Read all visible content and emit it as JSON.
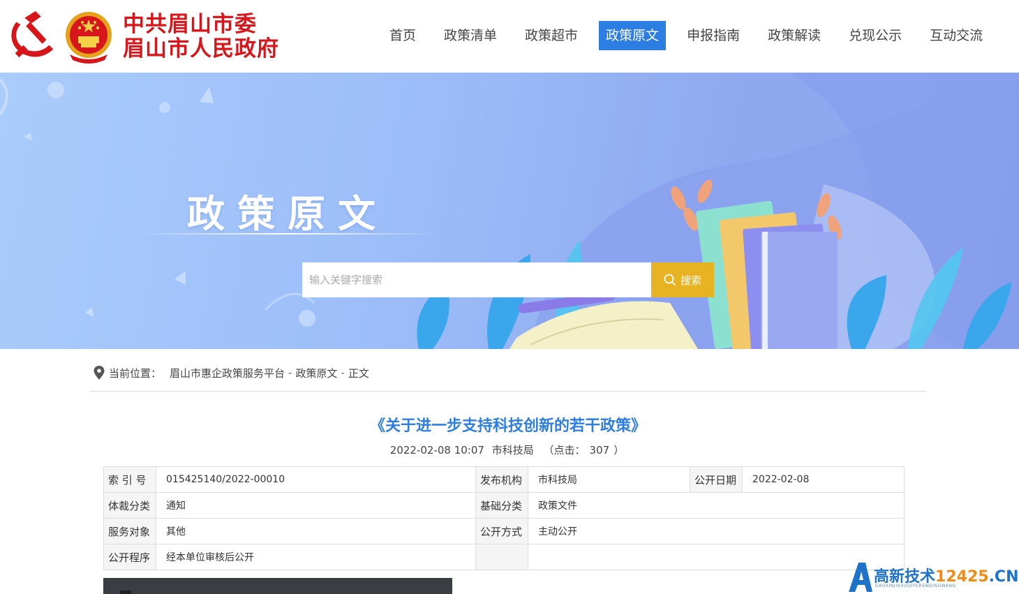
{
  "header": {
    "logo_line1": "中共眉山市委",
    "logo_line2": "眉山市人民政府",
    "nav": [
      {
        "label": "首页",
        "active": false
      },
      {
        "label": "政策清单",
        "active": false
      },
      {
        "label": "政策超市",
        "active": false
      },
      {
        "label": "政策原文",
        "active": true
      },
      {
        "label": "申报指南",
        "active": false
      },
      {
        "label": "政策解读",
        "active": false
      },
      {
        "label": "兑现公示",
        "active": false
      },
      {
        "label": "互动交流",
        "active": false
      }
    ]
  },
  "banner": {
    "title": "政策原文",
    "search_placeholder": "输入关键字搜索",
    "search_button": "搜索"
  },
  "breadcrumb": {
    "label": "当前位置：",
    "items": [
      "眉山市惠企政策服务平台",
      "政策原文",
      "正文"
    ],
    "separator": "-"
  },
  "article": {
    "title": "《关于进一步支持科技创新的若干政策》",
    "datetime": "2022-02-08 10:07",
    "publisher": "市科技局",
    "clicks_label": "（点击：",
    "clicks": "307",
    "clicks_close": "）"
  },
  "info": {
    "row1": {
      "k1": "索 引 号",
      "v1": "015425140/2022-00010",
      "k2": "发布机构",
      "v2": "市科技局",
      "k3": "公开日期",
      "v3": "2022-02-08"
    },
    "row2": {
      "k1": "体裁分类",
      "v1": "通知",
      "k2": "基础分类",
      "v2": "政策文件"
    },
    "row3": {
      "k1": "服务对象",
      "v1": "其他",
      "k2": "公开方式",
      "v2": "主动公开"
    },
    "row4": {
      "k1": "公开程序",
      "v1": "经本单位审核后公开"
    }
  },
  "watermark": {
    "text_a": "高新技术",
    "text_num": "12425",
    "text_b": ".CN",
    "sub": "GAOXINJISHUQIYERENDINGWANG"
  },
  "colors": {
    "brand_red": "#d7161b",
    "nav_active": "#2d7ee3",
    "search_button": "#e8b323",
    "title_blue": "#2d7ee3"
  }
}
